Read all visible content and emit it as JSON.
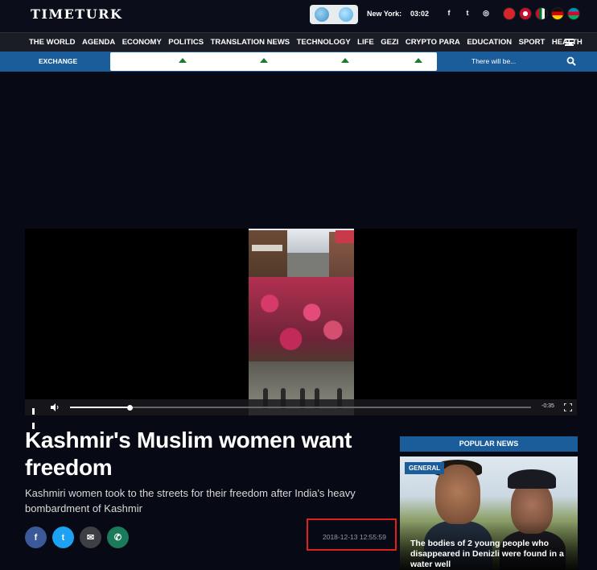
{
  "header": {
    "logo": "TIMETURK",
    "city": "New York:",
    "time": "03:02",
    "social": [
      "f",
      "t",
      "◎"
    ],
    "flags": [
      {
        "name": "turkey",
        "color": "#d8242c"
      },
      {
        "name": "uk",
        "color": "#c8102e"
      },
      {
        "name": "uae",
        "color": "#00732f"
      },
      {
        "name": "germany",
        "color": "#dd0000"
      },
      {
        "name": "azerbaijan",
        "color": "#0092bc"
      }
    ]
  },
  "nav": {
    "items": [
      "THE WORLD",
      "AGENDA",
      "ECONOMY",
      "POLITICS",
      "TRANSLATION NEWS",
      "TECHNOLOGY",
      "LIFE",
      "GEZI",
      "CRYPTO PARA",
      "EDUCATION",
      "SPORT",
      "HEALTH"
    ]
  },
  "exchange": {
    "label": "EXCHANGE",
    "search_placeholder": "There will be..."
  },
  "video": {
    "time_remaining": "-0:35",
    "progress": 0.13
  },
  "article": {
    "headline": "Kashmir's Muslim women want freedom",
    "summary": "Kashmiri women took to the streets for their freedom after India's heavy bombardment of Kashmir",
    "date": "2018-12-13 12:55:59",
    "share": [
      "f",
      "t",
      "✉",
      "✆"
    ]
  },
  "sidebar": {
    "popular_label": "POPULAR NEWS",
    "card": {
      "category": "GENERAL",
      "title": "The bodies of 2 young people who disappeared in Denizli were found in a water well"
    }
  },
  "colors": {
    "accent": "#1b5d9a",
    "background": "#070a14",
    "highlight_box": "#e0201b"
  }
}
